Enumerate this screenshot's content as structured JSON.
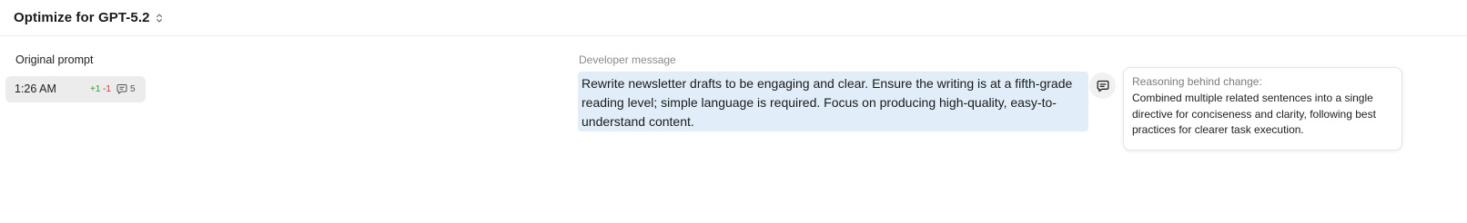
{
  "header": {
    "model_title": "Optimize for GPT-5.2",
    "model_switch_icon": "chevron-up-down-icon"
  },
  "sidebar": {
    "section_label": "Original prompt",
    "versions": [
      {
        "time": "1:26 AM",
        "additions": "+1",
        "deletions": "-1",
        "comment_count": "5",
        "comment_icon": "comment-icon"
      }
    ]
  },
  "main": {
    "section_label": "Developer message",
    "message": "Rewrite newsletter drafts to be engaging and clear. Ensure the writing is at a fifth-grade reading level; simple language is required. Focus on producing high-quality, easy-to-understand content.",
    "comment_button_icon": "comment-icon"
  },
  "reasoning": {
    "title": "Reasoning behind change:",
    "body": "Combined multiple related sentences into a single directive for conciseness and clarity, following best practices for clearer task execution."
  },
  "colors": {
    "message_highlight": "#e1eefa",
    "additions": "#2e9e3e",
    "deletions": "#d9362b"
  }
}
